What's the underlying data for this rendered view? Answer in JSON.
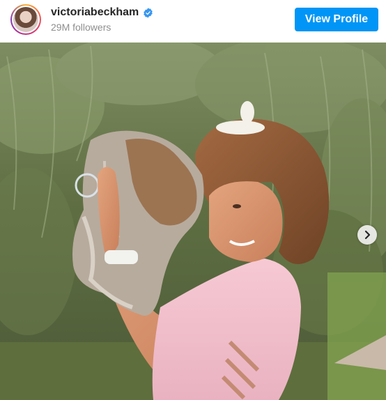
{
  "post": {
    "username": "victoriabeckham",
    "followers": "29M followers",
    "view_profile_label": "View Profile",
    "verified": true
  },
  "colors": {
    "button_blue": "#0095f6",
    "verified_blue": "#3897f0",
    "muted_text": "#8e8e8e"
  },
  "icons": {
    "verified": "verified-badge-icon",
    "next": "chevron-right-icon"
  },
  "media": {
    "type": "photo",
    "has_next": true
  }
}
